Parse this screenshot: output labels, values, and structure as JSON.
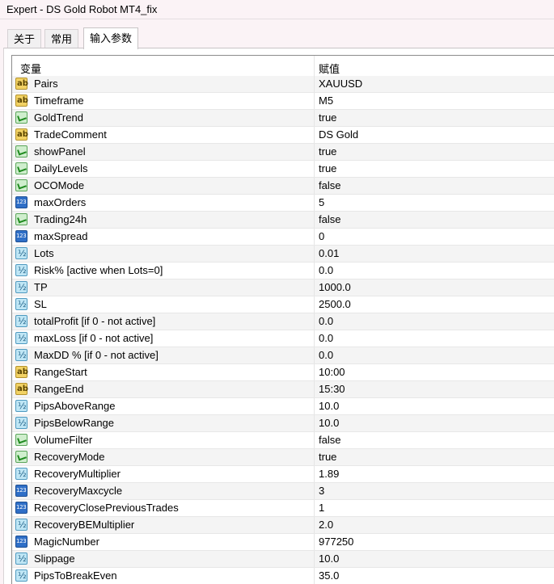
{
  "window": {
    "title": "Expert - DS Gold Robot MT4_fix"
  },
  "tabs": [
    {
      "label": "关于",
      "active": false
    },
    {
      "label": "常用",
      "active": false
    },
    {
      "label": "输入参数",
      "active": true
    }
  ],
  "table": {
    "columns": {
      "variable": "变量",
      "value": "赋值"
    },
    "rows": [
      {
        "icon": "ab",
        "name": "Pairs",
        "value": "XAUUSD"
      },
      {
        "icon": "ab",
        "name": "Timeframe",
        "value": "M5"
      },
      {
        "icon": "bool",
        "name": "GoldTrend",
        "value": "true"
      },
      {
        "icon": "ab",
        "name": "TradeComment",
        "value": "DS Gold"
      },
      {
        "icon": "bool",
        "name": "showPanel",
        "value": "true"
      },
      {
        "icon": "bool",
        "name": "DailyLevels",
        "value": "true"
      },
      {
        "icon": "bool",
        "name": "OCOMode",
        "value": "false"
      },
      {
        "icon": "int",
        "name": "maxOrders",
        "value": "5"
      },
      {
        "icon": "bool",
        "name": "Trading24h",
        "value": "false"
      },
      {
        "icon": "int",
        "name": "maxSpread",
        "value": "0"
      },
      {
        "icon": "dbl",
        "name": "Lots",
        "value": "0.01"
      },
      {
        "icon": "dbl",
        "name": "Risk% [active when Lots=0]",
        "value": "0.0"
      },
      {
        "icon": "dbl",
        "name": "TP",
        "value": "1000.0"
      },
      {
        "icon": "dbl",
        "name": "SL",
        "value": "2500.0"
      },
      {
        "icon": "dbl",
        "name": "totalProfit [if 0 - not active]",
        "value": "0.0"
      },
      {
        "icon": "dbl",
        "name": "maxLoss [if 0 - not active]",
        "value": "0.0"
      },
      {
        "icon": "dbl",
        "name": "MaxDD % [if 0 - not active]",
        "value": "0.0"
      },
      {
        "icon": "ab",
        "name": "RangeStart",
        "value": "10:00"
      },
      {
        "icon": "ab",
        "name": "RangeEnd",
        "value": "15:30"
      },
      {
        "icon": "dbl",
        "name": "PipsAboveRange",
        "value": "10.0"
      },
      {
        "icon": "dbl",
        "name": "PipsBelowRange",
        "value": "10.0"
      },
      {
        "icon": "bool",
        "name": "VolumeFilter",
        "value": "false"
      },
      {
        "icon": "bool",
        "name": "RecoveryMode",
        "value": "true"
      },
      {
        "icon": "dbl",
        "name": "RecoveryMultiplier",
        "value": "1.89"
      },
      {
        "icon": "int",
        "name": "RecoveryMaxcycle",
        "value": "3"
      },
      {
        "icon": "int",
        "name": "RecoveryClosePreviousTrades",
        "value": "1"
      },
      {
        "icon": "dbl",
        "name": "RecoveryBEMultiplier",
        "value": "2.0"
      },
      {
        "icon": "int",
        "name": "MagicNumber",
        "value": "977250"
      },
      {
        "icon": "dbl",
        "name": "Slippage",
        "value": "10.0"
      },
      {
        "icon": "dbl",
        "name": "PipsToBreakEven",
        "value": "35.0"
      }
    ]
  }
}
